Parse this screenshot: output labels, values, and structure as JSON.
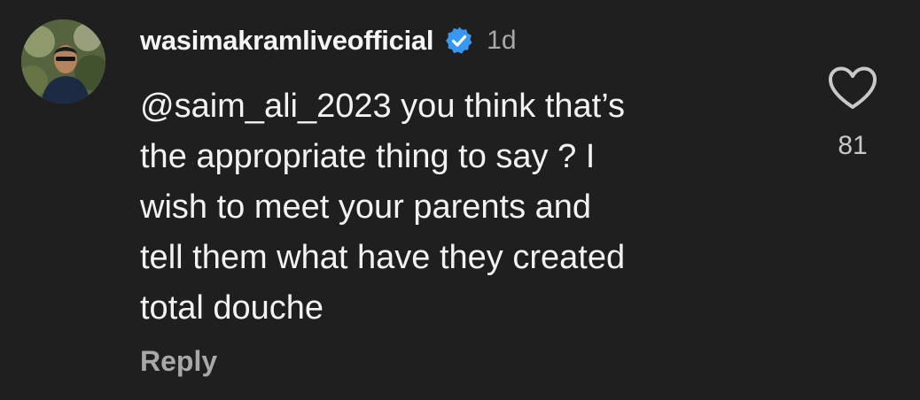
{
  "comment": {
    "username": "wasimakramliveofficial",
    "verified": true,
    "time": "1d",
    "text": "@saim_ali_2023 you think that’s\nthe appropriate thing to say ? I\nwish to meet your parents and\ntell them what have they created\ntotal douche",
    "reply_label": "Reply",
    "like_count": "81",
    "avatar_icon": "profile-avatar",
    "verified_icon": "verified-badge-icon",
    "like_icon": "heart-outline-icon"
  },
  "colors": {
    "background": "#1f1f1f",
    "verified_blue": "#3897f0",
    "muted_text": "#a8a8a8",
    "primary_text": "#f2f2f2"
  }
}
